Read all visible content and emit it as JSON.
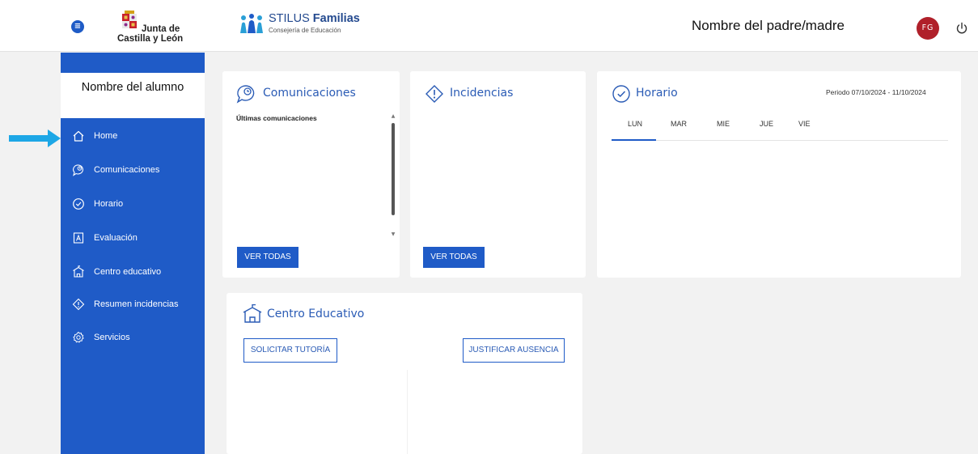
{
  "header": {
    "menu_icon": "hamburger-icon",
    "logo_line1": "Junta de",
    "logo_line2": "Castilla y León",
    "app_name_light": "STILUS ",
    "app_name_bold": "Familias",
    "app_subtitle": "Consejería de Educación",
    "parent_name": "Nombre del padre/madre",
    "avatar_initials": "FG",
    "power_icon": "power-icon",
    "colors": {
      "avatar": "#b0202a",
      "brand_blue": "#1f5bc7"
    }
  },
  "sidebar": {
    "student_name": "Nombre del alumno",
    "items": [
      {
        "label": "Home",
        "icon": "home-icon"
      },
      {
        "label": "Comunicaciones",
        "icon": "chat-clock-icon"
      },
      {
        "label": "Horario",
        "icon": "clock-icon"
      },
      {
        "label": "Evaluación",
        "icon": "evaluation-icon"
      },
      {
        "label": "Centro educativo",
        "icon": "school-icon"
      },
      {
        "label": "Resumen incidencias",
        "icon": "warning-diamond-icon"
      },
      {
        "label": "Servicios",
        "icon": "gear-icon"
      }
    ]
  },
  "cards": {
    "comunicaciones": {
      "title": "Comunicaciones",
      "subtitle": "Últimas comunicaciones",
      "button": "VER TODAS"
    },
    "incidencias": {
      "title": "Incidencias",
      "button": "VER TODAS"
    },
    "horario": {
      "title": "Horario",
      "period": "Periodo 07/10/2024 - 11/10/2024",
      "days": [
        "LUN",
        "MAR",
        "MIE",
        "JUE",
        "VIE"
      ],
      "selected_day": "LUN"
    },
    "centro": {
      "title": "Centro Educativo",
      "button_tutoria": "SOLICITAR TUTORÍA",
      "button_ausencia": "JUSTIFICAR AUSENCIA"
    }
  }
}
